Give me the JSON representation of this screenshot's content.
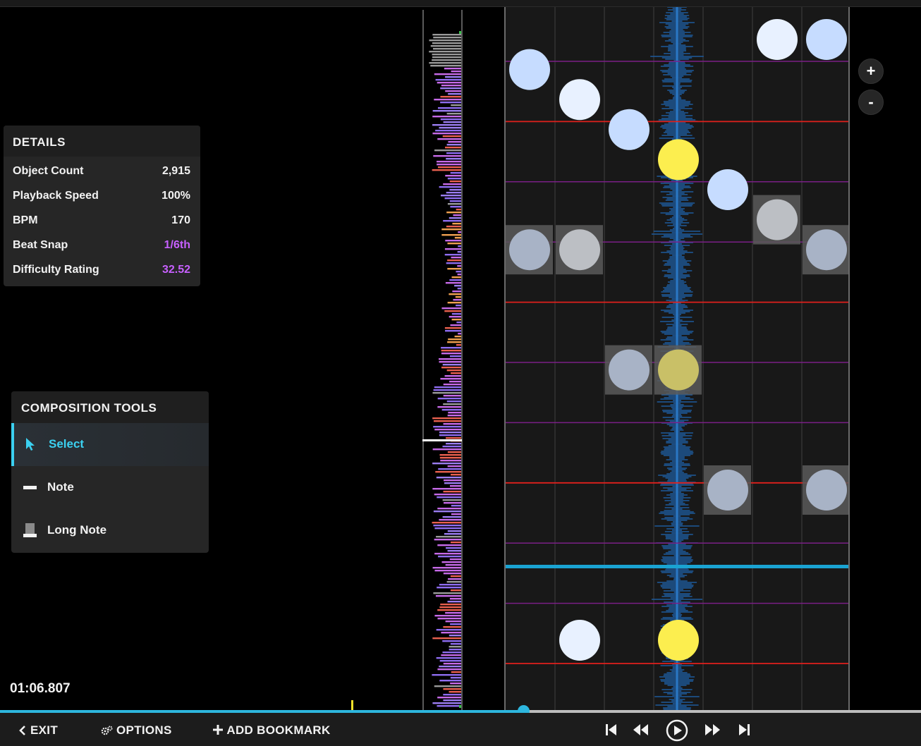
{
  "details": {
    "title": "DETAILS",
    "rows": [
      {
        "label": "Object Count",
        "value": "2,915",
        "accent": false
      },
      {
        "label": "Playback Speed",
        "value": "100%",
        "accent": false
      },
      {
        "label": "BPM",
        "value": "170",
        "accent": false
      },
      {
        "label": "Beat Snap",
        "value": "1/6th",
        "accent": true
      },
      {
        "label": "Difficulty Rating",
        "value": "32.52",
        "accent": true
      }
    ]
  },
  "tools": {
    "title": "COMPOSITION TOOLS",
    "items": [
      {
        "label": "Select",
        "icon": "cursor-icon",
        "active": true
      },
      {
        "label": "Note",
        "icon": "note-icon",
        "active": false
      },
      {
        "label": "Long Note",
        "icon": "long-note-icon",
        "active": false
      }
    ]
  },
  "playback": {
    "time": "01:06.807",
    "seek_progress": 0.568
  },
  "zoom": {
    "in_label": "+",
    "out_label": "-"
  },
  "bottom": {
    "exit_label": "EXIT",
    "options_label": "OPTIONS",
    "bookmark_label": "ADD BOOKMARK",
    "controls": [
      "skip-start-icon",
      "rewind-icon",
      "play-icon",
      "fast-forward-icon",
      "skip-end-icon"
    ]
  },
  "colors": {
    "accent": "#2db6de",
    "select_active": "#3bd0f0",
    "purple_value": "#c760ff",
    "note_white": "#e8f1ff",
    "note_blue": "#c6dcff",
    "note_yellow": "#fcee4f",
    "snap_red": "#e0201c",
    "snap_purple": "#7a1f86",
    "hitline": "#1aa3d2"
  },
  "editor": {
    "lanes": 7,
    "notes": [
      {
        "lane": 6,
        "row": 0,
        "color": "white",
        "selected": false
      },
      {
        "lane": 7,
        "row": 0,
        "color": "blue",
        "selected": false
      },
      {
        "lane": 1,
        "row": 1,
        "color": "blue",
        "selected": false
      },
      {
        "lane": 2,
        "row": 2,
        "color": "white",
        "selected": false
      },
      {
        "lane": 3,
        "row": 3,
        "color": "blue",
        "selected": false
      },
      {
        "lane": 4,
        "row": 4,
        "color": "yellow",
        "selected": false
      },
      {
        "lane": 5,
        "row": 5,
        "color": "blue",
        "selected": false
      },
      {
        "lane": 6,
        "row": 6,
        "color": "white",
        "selected": true
      },
      {
        "lane": 1,
        "row": 7,
        "color": "blue",
        "selected": true
      },
      {
        "lane": 2,
        "row": 7,
        "color": "white",
        "selected": true
      },
      {
        "lane": 7,
        "row": 7,
        "color": "blue",
        "selected": true
      },
      {
        "lane": 3,
        "row": 11,
        "color": "blue",
        "selected": true
      },
      {
        "lane": 4,
        "row": 11,
        "color": "yellow",
        "selected": true
      },
      {
        "lane": 5,
        "row": 15,
        "color": "blue",
        "selected": true
      },
      {
        "lane": 7,
        "row": 15,
        "color": "blue",
        "selected": true
      },
      {
        "lane": 2,
        "row": 20,
        "color": "white",
        "selected": false
      },
      {
        "lane": 4,
        "row": 20,
        "color": "yellow",
        "selected": false
      }
    ]
  }
}
